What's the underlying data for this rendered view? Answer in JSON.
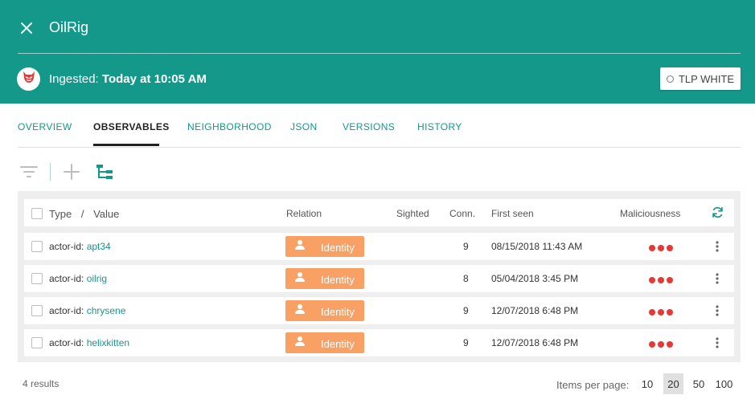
{
  "header": {
    "title": "OilRig",
    "ingested_label": "Ingested:",
    "ingested_value": "Today at 10:05 AM",
    "tlp_label": "TLP WHITE"
  },
  "tabs": [
    {
      "label": "OVERVIEW",
      "active": false
    },
    {
      "label": "OBSERVABLES",
      "active": true
    },
    {
      "label": "NEIGHBORHOOD",
      "active": false
    },
    {
      "label": "JSON",
      "active": false
    },
    {
      "label": "VERSIONS",
      "active": false
    },
    {
      "label": "HISTORY",
      "active": false
    }
  ],
  "table": {
    "headers": {
      "type": "Type",
      "sep": "/",
      "value": "Value",
      "relation": "Relation",
      "sighted": "Sighted",
      "conn": "Conn.",
      "first_seen": "First seen",
      "maliciousness": "Maliciousness"
    },
    "rows": [
      {
        "type": "actor-id:",
        "value": "apt34",
        "relation": "Identity",
        "sighted": "",
        "conn": "9",
        "first_seen": "08/15/2018 11:43 AM"
      },
      {
        "type": "actor-id:",
        "value": "oilrig",
        "relation": "Identity",
        "sighted": "",
        "conn": "8",
        "first_seen": "05/04/2018 3:45 PM"
      },
      {
        "type": "actor-id:",
        "value": "chrysene",
        "relation": "Identity",
        "sighted": "",
        "conn": "9",
        "first_seen": "12/07/2018 6:48 PM"
      },
      {
        "type": "actor-id:",
        "value": "helixkitten",
        "relation": "Identity",
        "sighted": "",
        "conn": "9",
        "first_seen": "12/07/2018 6:48 PM"
      }
    ]
  },
  "footer": {
    "results": "4 results",
    "items_per_page_label": "Items per page:",
    "page_sizes": [
      "10",
      "20",
      "50",
      "100"
    ],
    "selected_page_size": "20"
  },
  "colors": {
    "brand": "#14988a",
    "relation_badge": "#f9a064",
    "maliciousness_dot": "#e53935"
  }
}
